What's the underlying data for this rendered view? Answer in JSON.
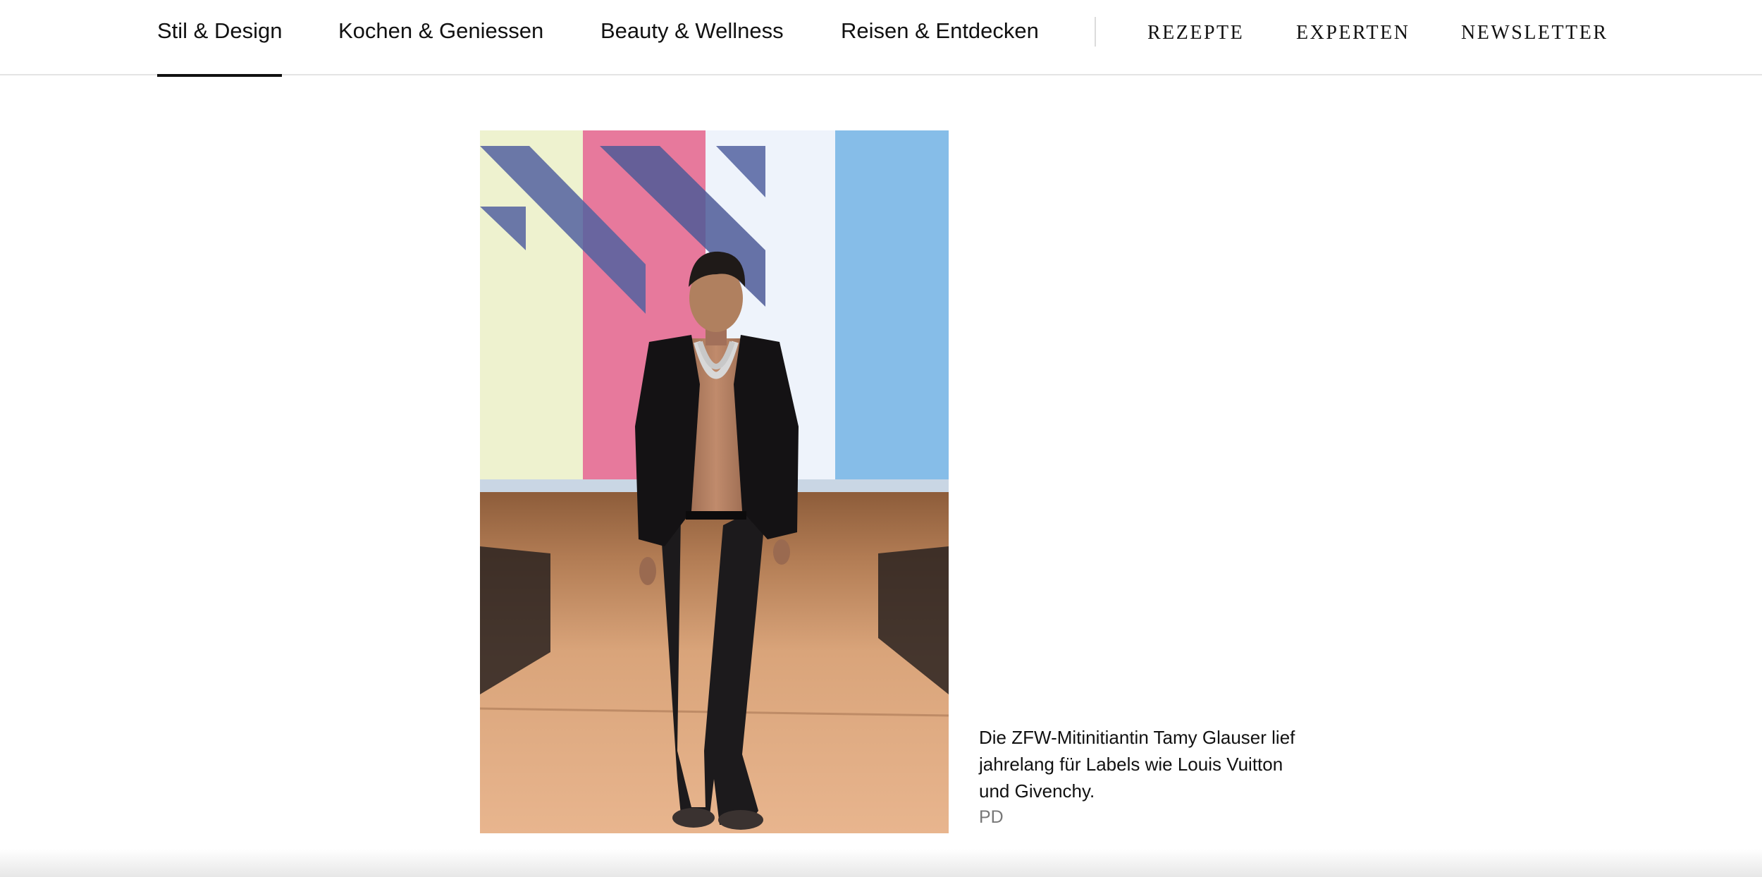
{
  "nav": {
    "categories": [
      {
        "label": "Stil & Design",
        "active": true
      },
      {
        "label": "Kochen & Geniessen",
        "active": false
      },
      {
        "label": "Beauty & Wellness",
        "active": false
      },
      {
        "label": "Reisen & Entdecken",
        "active": false
      }
    ],
    "utility": [
      "REZEPTE",
      "EXPERTEN",
      "NEWSLETTER"
    ]
  },
  "figure": {
    "image_subject": "runway-model-photo",
    "caption": "Die ZFW-Mitinitiantin Tamy Glauser lief jahrelang für Labels wie Louis Vuitton und Givenchy.",
    "credit": "PD"
  },
  "colors": {
    "text": "#111111",
    "credit": "#777777",
    "divider": "#e4e4e4"
  }
}
